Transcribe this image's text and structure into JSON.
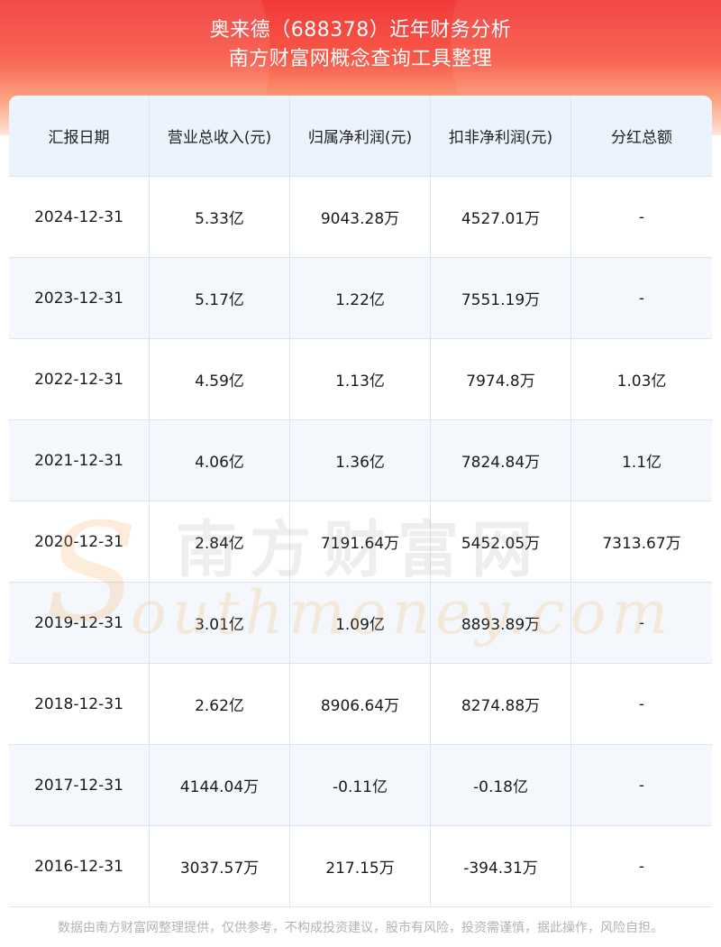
{
  "header": {
    "title": "奥来德（688378）近年财务分析",
    "subtitle": "南方财富网概念查询工具整理"
  },
  "table": {
    "columns": [
      "汇报日期",
      "营业总收入(元)",
      "归属净利润(元)",
      "扣非净利润(元)",
      "分红总额"
    ],
    "rows": [
      [
        "2024-12-31",
        "5.33亿",
        "9043.28万",
        "4527.01万",
        "-"
      ],
      [
        "2023-12-31",
        "5.17亿",
        "1.22亿",
        "7551.19万",
        "-"
      ],
      [
        "2022-12-31",
        "4.59亿",
        "1.13亿",
        "7974.8万",
        "1.03亿"
      ],
      [
        "2021-12-31",
        "4.06亿",
        "1.36亿",
        "7824.84万",
        "1.1亿"
      ],
      [
        "2020-12-31",
        "2.84亿",
        "7191.64万",
        "5452.05万",
        "7313.67万"
      ],
      [
        "2019-12-31",
        "3.01亿",
        "1.09亿",
        "8893.89万",
        "-"
      ],
      [
        "2018-12-31",
        "2.62亿",
        "8906.64万",
        "8274.88万",
        "-"
      ],
      [
        "2017-12-31",
        "4144.04万",
        "-0.11亿",
        "-0.18亿",
        "-"
      ],
      [
        "2016-12-31",
        "3037.57万",
        "217.15万",
        "-394.31万",
        "-"
      ]
    ]
  },
  "watermark": {
    "letter": "S",
    "cn": "南方财富网",
    "en": "outhmoney.com"
  },
  "footer": {
    "disclaimer": "数据由南方财富网整理提供，仅供参考，不构成投资建议，股市有风险，投资需谨慎，据此操作，风险自担。"
  }
}
